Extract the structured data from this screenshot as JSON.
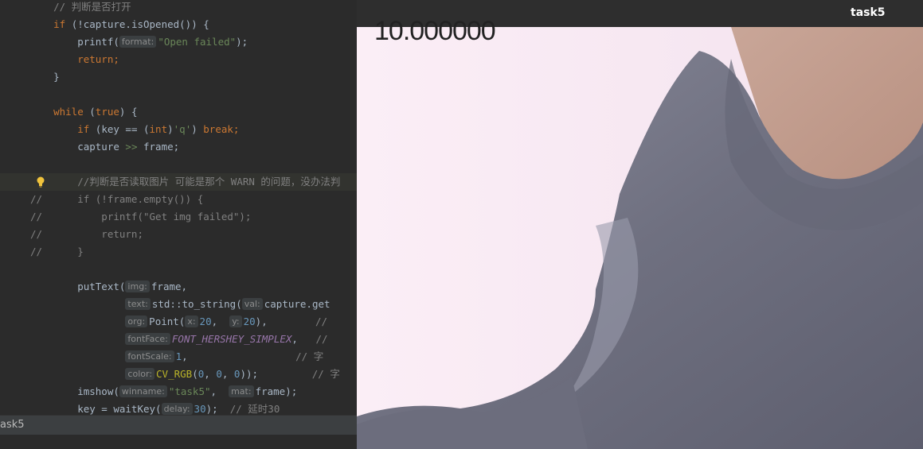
{
  "editor": {
    "lines": [
      {
        "gutter": "",
        "parts": [
          {
            "c": "cmt",
            "t": "    // 判断是否打开"
          }
        ]
      },
      {
        "gutter": "",
        "parts": [
          {
            "c": "kw",
            "t": "    if "
          },
          {
            "c": "op",
            "t": "(!capture.isOpened()) {"
          }
        ]
      },
      {
        "gutter": "",
        "parts": [
          {
            "c": "op",
            "t": "        printf("
          },
          {
            "c": "hint",
            "t": "format:"
          },
          {
            "c": "str",
            "t": "\"Open failed\""
          },
          {
            "c": "op",
            "t": ");"
          }
        ]
      },
      {
        "gutter": "",
        "parts": [
          {
            "c": "kw",
            "t": "        return;"
          }
        ]
      },
      {
        "gutter": "",
        "parts": [
          {
            "c": "op",
            "t": "    }"
          }
        ]
      },
      {
        "gutter": "",
        "parts": [
          {
            "c": "op",
            "t": ""
          }
        ]
      },
      {
        "gutter": "",
        "parts": [
          {
            "c": "kw",
            "t": "    while "
          },
          {
            "c": "op",
            "t": "("
          },
          {
            "c": "kw",
            "t": "true"
          },
          {
            "c": "op",
            "t": ") {"
          }
        ]
      },
      {
        "gutter": "",
        "parts": [
          {
            "c": "kw",
            "t": "        if "
          },
          {
            "c": "op",
            "t": "(key == ("
          },
          {
            "c": "kw",
            "t": "int"
          },
          {
            "c": "op",
            "t": ")"
          },
          {
            "c": "str",
            "t": "'q'"
          },
          {
            "c": "op",
            "t": ") "
          },
          {
            "c": "kw",
            "t": "break;"
          }
        ]
      },
      {
        "gutter": "",
        "parts": [
          {
            "c": "op",
            "t": "        capture "
          },
          {
            "c": "str",
            "t": ">>"
          },
          {
            "c": "op",
            "t": " frame;"
          }
        ]
      },
      {
        "gutter": "",
        "parts": [
          {
            "c": "op",
            "t": ""
          }
        ]
      },
      {
        "gutter": "",
        "parts": [
          {
            "c": "cmt",
            "t": "        //判断是否读取图片 可能是那个 WARN 的问题，没办法判"
          }
        ],
        "hl": true,
        "bulb": true
      },
      {
        "gutter": "//",
        "parts": [
          {
            "c": "cmt",
            "t": "        if (!frame.empty()) {"
          }
        ]
      },
      {
        "gutter": "//",
        "parts": [
          {
            "c": "cmt",
            "t": "            printf(\"Get img failed\");"
          }
        ]
      },
      {
        "gutter": "//",
        "parts": [
          {
            "c": "cmt",
            "t": "            return;"
          }
        ]
      },
      {
        "gutter": "//",
        "parts": [
          {
            "c": "cmt",
            "t": "        }"
          }
        ]
      },
      {
        "gutter": "",
        "parts": [
          {
            "c": "op",
            "t": ""
          }
        ]
      },
      {
        "gutter": "",
        "parts": [
          {
            "c": "op",
            "t": "        putText("
          },
          {
            "c": "hint",
            "t": "img:"
          },
          {
            "c": "op",
            "t": "frame,"
          }
        ]
      },
      {
        "gutter": "",
        "parts": [
          {
            "c": "op",
            "t": "                "
          },
          {
            "c": "hint",
            "t": "text:"
          },
          {
            "c": "op",
            "t": "std::to_string("
          },
          {
            "c": "hint",
            "t": "val:"
          },
          {
            "c": "op",
            "t": "capture.get"
          }
        ]
      },
      {
        "gutter": "",
        "parts": [
          {
            "c": "op",
            "t": "                "
          },
          {
            "c": "hint",
            "t": "org:"
          },
          {
            "c": "op",
            "t": "Point("
          },
          {
            "c": "hint",
            "t": "x:"
          },
          {
            "c": "num",
            "t": "20"
          },
          {
            "c": "op",
            "t": ",  "
          },
          {
            "c": "hint",
            "t": "y:"
          },
          {
            "c": "num",
            "t": "20"
          },
          {
            "c": "op",
            "t": "),"
          },
          {
            "c": "cmt",
            "t": "        //"
          }
        ]
      },
      {
        "gutter": "",
        "parts": [
          {
            "c": "op",
            "t": "                "
          },
          {
            "c": "hint",
            "t": "fontFace:"
          },
          {
            "c": "const",
            "t": "FONT_HERSHEY_SIMPLEX"
          },
          {
            "c": "op",
            "t": ","
          },
          {
            "c": "cmt",
            "t": "   //"
          }
        ]
      },
      {
        "gutter": "",
        "parts": [
          {
            "c": "op",
            "t": "                "
          },
          {
            "c": "hint",
            "t": "fontScale:"
          },
          {
            "c": "num",
            "t": "1"
          },
          {
            "c": "op",
            "t": ","
          },
          {
            "c": "cmt",
            "t": "                  // 字"
          }
        ]
      },
      {
        "gutter": "",
        "parts": [
          {
            "c": "op",
            "t": "                "
          },
          {
            "c": "hint",
            "t": "color:"
          },
          {
            "c": "macro",
            "t": "CV_RGB"
          },
          {
            "c": "op",
            "t": "("
          },
          {
            "c": "num",
            "t": "0"
          },
          {
            "c": "op",
            "t": ", "
          },
          {
            "c": "num",
            "t": "0"
          },
          {
            "c": "op",
            "t": ", "
          },
          {
            "c": "num",
            "t": "0"
          },
          {
            "c": "op",
            "t": "));"
          },
          {
            "c": "cmt",
            "t": "         // 字"
          }
        ]
      },
      {
        "gutter": "",
        "parts": [
          {
            "c": "op",
            "t": "        imshow("
          },
          {
            "c": "hint",
            "t": "winname:"
          },
          {
            "c": "str",
            "t": "\"task5\""
          },
          {
            "c": "op",
            "t": ",  "
          },
          {
            "c": "hint",
            "t": "mat:"
          },
          {
            "c": "op",
            "t": "frame);"
          }
        ]
      },
      {
        "gutter": "",
        "parts": [
          {
            "c": "op",
            "t": "        key = waitKey("
          },
          {
            "c": "hint",
            "t": "delay:"
          },
          {
            "c": "num",
            "t": "30"
          },
          {
            "c": "op",
            "t": ");  "
          },
          {
            "c": "cmt",
            "t": "// 延时30"
          }
        ]
      }
    ],
    "status_text": "ask5"
  },
  "cv_window": {
    "title": "task5",
    "overlay_text": "10.000000"
  },
  "colors": {
    "editor_bg": "#2b2b2b",
    "keyword": "#cc7832",
    "string": "#6a8759",
    "comment": "#808080",
    "number": "#6897bb",
    "frame_bg": "#f6e8f2",
    "jacket": "#7d7e8e"
  }
}
